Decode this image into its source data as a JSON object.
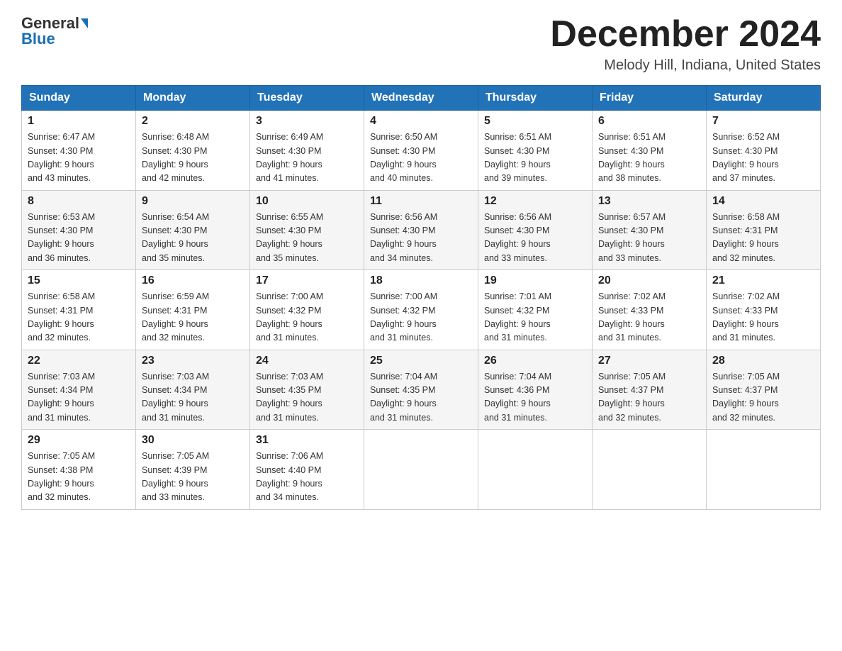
{
  "header": {
    "logo_general": "General",
    "logo_blue": "Blue",
    "month_title": "December 2024",
    "location": "Melody Hill, Indiana, United States"
  },
  "weekdays": [
    "Sunday",
    "Monday",
    "Tuesday",
    "Wednesday",
    "Thursday",
    "Friday",
    "Saturday"
  ],
  "weeks": [
    [
      {
        "day": "1",
        "sunrise": "6:47 AM",
        "sunset": "4:30 PM",
        "daylight": "9 hours and 43 minutes."
      },
      {
        "day": "2",
        "sunrise": "6:48 AM",
        "sunset": "4:30 PM",
        "daylight": "9 hours and 42 minutes."
      },
      {
        "day": "3",
        "sunrise": "6:49 AM",
        "sunset": "4:30 PM",
        "daylight": "9 hours and 41 minutes."
      },
      {
        "day": "4",
        "sunrise": "6:50 AM",
        "sunset": "4:30 PM",
        "daylight": "9 hours and 40 minutes."
      },
      {
        "day": "5",
        "sunrise": "6:51 AM",
        "sunset": "4:30 PM",
        "daylight": "9 hours and 39 minutes."
      },
      {
        "day": "6",
        "sunrise": "6:51 AM",
        "sunset": "4:30 PM",
        "daylight": "9 hours and 38 minutes."
      },
      {
        "day": "7",
        "sunrise": "6:52 AM",
        "sunset": "4:30 PM",
        "daylight": "9 hours and 37 minutes."
      }
    ],
    [
      {
        "day": "8",
        "sunrise": "6:53 AM",
        "sunset": "4:30 PM",
        "daylight": "9 hours and 36 minutes."
      },
      {
        "day": "9",
        "sunrise": "6:54 AM",
        "sunset": "4:30 PM",
        "daylight": "9 hours and 35 minutes."
      },
      {
        "day": "10",
        "sunrise": "6:55 AM",
        "sunset": "4:30 PM",
        "daylight": "9 hours and 35 minutes."
      },
      {
        "day": "11",
        "sunrise": "6:56 AM",
        "sunset": "4:30 PM",
        "daylight": "9 hours and 34 minutes."
      },
      {
        "day": "12",
        "sunrise": "6:56 AM",
        "sunset": "4:30 PM",
        "daylight": "9 hours and 33 minutes."
      },
      {
        "day": "13",
        "sunrise": "6:57 AM",
        "sunset": "4:30 PM",
        "daylight": "9 hours and 33 minutes."
      },
      {
        "day": "14",
        "sunrise": "6:58 AM",
        "sunset": "4:31 PM",
        "daylight": "9 hours and 32 minutes."
      }
    ],
    [
      {
        "day": "15",
        "sunrise": "6:58 AM",
        "sunset": "4:31 PM",
        "daylight": "9 hours and 32 minutes."
      },
      {
        "day": "16",
        "sunrise": "6:59 AM",
        "sunset": "4:31 PM",
        "daylight": "9 hours and 32 minutes."
      },
      {
        "day": "17",
        "sunrise": "7:00 AM",
        "sunset": "4:32 PM",
        "daylight": "9 hours and 31 minutes."
      },
      {
        "day": "18",
        "sunrise": "7:00 AM",
        "sunset": "4:32 PM",
        "daylight": "9 hours and 31 minutes."
      },
      {
        "day": "19",
        "sunrise": "7:01 AM",
        "sunset": "4:32 PM",
        "daylight": "9 hours and 31 minutes."
      },
      {
        "day": "20",
        "sunrise": "7:02 AM",
        "sunset": "4:33 PM",
        "daylight": "9 hours and 31 minutes."
      },
      {
        "day": "21",
        "sunrise": "7:02 AM",
        "sunset": "4:33 PM",
        "daylight": "9 hours and 31 minutes."
      }
    ],
    [
      {
        "day": "22",
        "sunrise": "7:03 AM",
        "sunset": "4:34 PM",
        "daylight": "9 hours and 31 minutes."
      },
      {
        "day": "23",
        "sunrise": "7:03 AM",
        "sunset": "4:34 PM",
        "daylight": "9 hours and 31 minutes."
      },
      {
        "day": "24",
        "sunrise": "7:03 AM",
        "sunset": "4:35 PM",
        "daylight": "9 hours and 31 minutes."
      },
      {
        "day": "25",
        "sunrise": "7:04 AM",
        "sunset": "4:35 PM",
        "daylight": "9 hours and 31 minutes."
      },
      {
        "day": "26",
        "sunrise": "7:04 AM",
        "sunset": "4:36 PM",
        "daylight": "9 hours and 31 minutes."
      },
      {
        "day": "27",
        "sunrise": "7:05 AM",
        "sunset": "4:37 PM",
        "daylight": "9 hours and 32 minutes."
      },
      {
        "day": "28",
        "sunrise": "7:05 AM",
        "sunset": "4:37 PM",
        "daylight": "9 hours and 32 minutes."
      }
    ],
    [
      {
        "day": "29",
        "sunrise": "7:05 AM",
        "sunset": "4:38 PM",
        "daylight": "9 hours and 32 minutes."
      },
      {
        "day": "30",
        "sunrise": "7:05 AM",
        "sunset": "4:39 PM",
        "daylight": "9 hours and 33 minutes."
      },
      {
        "day": "31",
        "sunrise": "7:06 AM",
        "sunset": "4:40 PM",
        "daylight": "9 hours and 34 minutes."
      },
      null,
      null,
      null,
      null
    ]
  ],
  "labels": {
    "sunrise": "Sunrise:",
    "sunset": "Sunset:",
    "daylight": "Daylight:"
  }
}
